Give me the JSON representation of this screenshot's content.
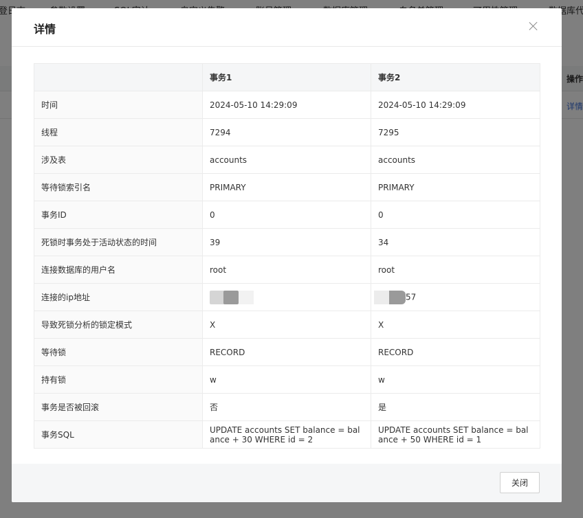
{
  "background": {
    "tabs": [
      "登日志",
      "参数设置",
      "SQL审计",
      "自定义告警",
      "账号管理",
      "数据库管理",
      "白名单管理",
      "可用性管理",
      "数据库代"
    ],
    "op_header": "操作",
    "op_link": "详情"
  },
  "modal": {
    "title": "详情",
    "headers": [
      "",
      "事务1",
      "事务2"
    ],
    "rows": [
      {
        "label": "时间",
        "t1": "2024-05-10 14:29:09",
        "t2": "2024-05-10 14:29:09"
      },
      {
        "label": "线程",
        "t1": "7294",
        "t2": "7295"
      },
      {
        "label": "涉及表",
        "t1": "accounts",
        "t2": "accounts"
      },
      {
        "label": "等待锁索引名",
        "t1": "PRIMARY",
        "t2": "PRIMARY"
      },
      {
        "label": "事务ID",
        "t1": "0",
        "t2": "0"
      },
      {
        "label": "死锁时事务处于活动状态的时间",
        "t1": "39",
        "t2": "34"
      },
      {
        "label": "连接数据库的用户名",
        "t1": "root",
        "t2": "root"
      },
      {
        "label": "连接的ip地址",
        "t1": "",
        "t2": "57"
      },
      {
        "label": "导致死锁分析的锁定模式",
        "t1": "X",
        "t2": "X"
      },
      {
        "label": "等待锁",
        "t1": "RECORD",
        "t2": "RECORD"
      },
      {
        "label": "持有锁",
        "t1": "w",
        "t2": "w"
      },
      {
        "label": "事务是否被回滚",
        "t1": "否",
        "t2": "是"
      },
      {
        "label": "事务SQL",
        "t1": "UPDATE accounts SET balance = balance + 30 WHERE id = 2",
        "t2": "UPDATE accounts SET balance = balance + 50 WHERE id = 1"
      }
    ],
    "footer_close_label": "关闭"
  }
}
